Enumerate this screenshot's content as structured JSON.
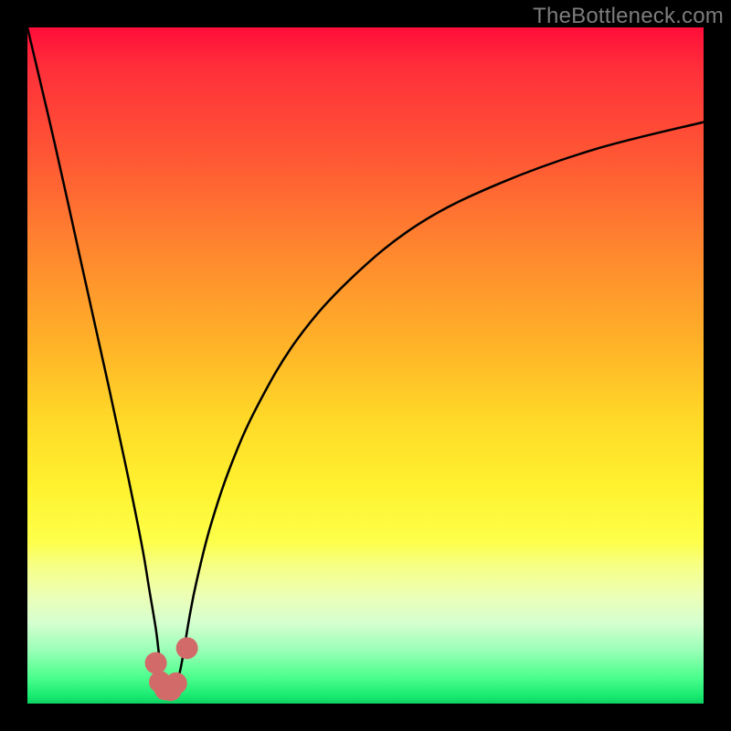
{
  "watermark": "TheBottleneck.com",
  "chart_data": {
    "type": "line",
    "title": "",
    "xlabel": "",
    "ylabel": "",
    "xlim": [
      0,
      100
    ],
    "ylim": [
      0,
      100
    ],
    "grid": false,
    "legend": false,
    "description": "Bottleneck curve with a sharp valley near x≈21 reaching y≈2, rising steeply to the left toward y≈100 and gradually to the right toward y≈86; background vertical gradient red (high) → green (low).",
    "series": [
      {
        "name": "bottleneck-curve",
        "color": "#000000",
        "x": [
          0,
          4,
          8,
          12,
          15,
          17,
          18,
          19,
          19.5,
          20,
          20.5,
          21,
          21.5,
          22,
          22.5,
          23,
          24,
          25,
          27,
          30,
          34,
          40,
          48,
          58,
          70,
          84,
          100
        ],
        "values": [
          100,
          83,
          65,
          47,
          33,
          23,
          17,
          11,
          7,
          4,
          2.3,
          1.8,
          2.1,
          3,
          4.5,
          7,
          13,
          18,
          26,
          35,
          44,
          54,
          63,
          71,
          77,
          82,
          86
        ]
      },
      {
        "name": "marker-cluster",
        "color": "#d36a6a",
        "type": "scatter",
        "x": [
          19.0,
          19.6,
          20.4,
          21.2,
          22.0,
          23.6
        ],
        "values": [
          6.0,
          3.2,
          2.1,
          2.0,
          3.0,
          8.2
        ]
      }
    ]
  }
}
